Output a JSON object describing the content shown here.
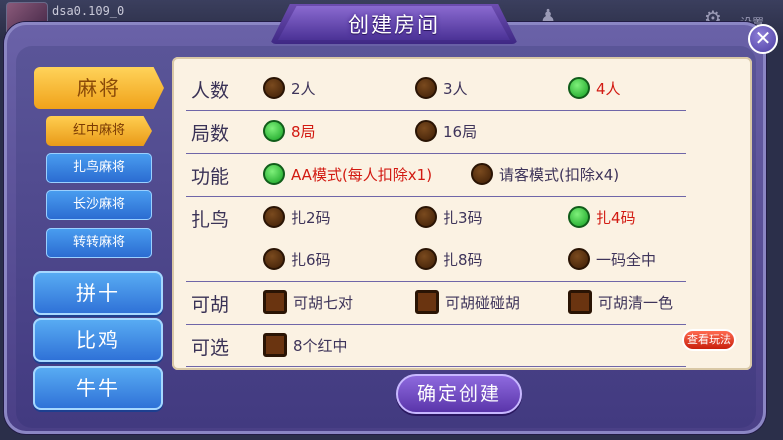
{
  "background": {
    "username": "dsa0.109_0",
    "settings_label": "设置"
  },
  "dialog": {
    "title": "创建房间",
    "close_symbol": "✕"
  },
  "sidebar": {
    "main_tab": "麻将",
    "sub_tabs": [
      {
        "label": "红中麻将",
        "active": true
      },
      {
        "label": "扎鸟麻将",
        "active": false
      },
      {
        "label": "长沙麻将",
        "active": false
      },
      {
        "label": "转转麻将",
        "active": false
      }
    ],
    "categories": [
      "拼十",
      "比鸡",
      "牛牛"
    ]
  },
  "options": {
    "players": {
      "label": "人数",
      "choices": [
        {
          "text": "2人",
          "selected": false
        },
        {
          "text": "3人",
          "selected": false
        },
        {
          "text": "4人",
          "selected": true
        }
      ]
    },
    "rounds": {
      "label": "局数",
      "choices": [
        {
          "text": "8局",
          "selected": true
        },
        {
          "text": "16局",
          "selected": false
        }
      ]
    },
    "function": {
      "label": "功能",
      "choices": [
        {
          "text": "AA模式(每人扣除x1)",
          "selected": true
        },
        {
          "text": "请客模式(扣除x4)",
          "selected": false
        }
      ]
    },
    "zhaniao": {
      "label": "扎鸟",
      "choices": [
        {
          "text": "扎2码",
          "selected": false
        },
        {
          "text": "扎3码",
          "selected": false
        },
        {
          "text": "扎4码",
          "selected": true
        },
        {
          "text": "扎6码",
          "selected": false
        },
        {
          "text": "扎8码",
          "selected": false
        },
        {
          "text": "一码全中",
          "selected": false
        }
      ]
    },
    "kehu": {
      "label": "可胡",
      "choices": [
        {
          "text": "可胡七对",
          "checked": false
        },
        {
          "text": "可胡碰碰胡",
          "checked": false
        },
        {
          "text": "可胡清一色",
          "checked": false
        }
      ]
    },
    "kexuan": {
      "label": "可选",
      "choices": [
        {
          "text": "8个红中",
          "checked": false
        }
      ]
    }
  },
  "buttons": {
    "rules": "查看玩法",
    "confirm": "确定创建"
  },
  "colors": {
    "selected_text": "#d21a12",
    "radio_on": "#14a022",
    "tab_active": "#f0a21a",
    "tab_inactive": "#2d6fd6"
  }
}
